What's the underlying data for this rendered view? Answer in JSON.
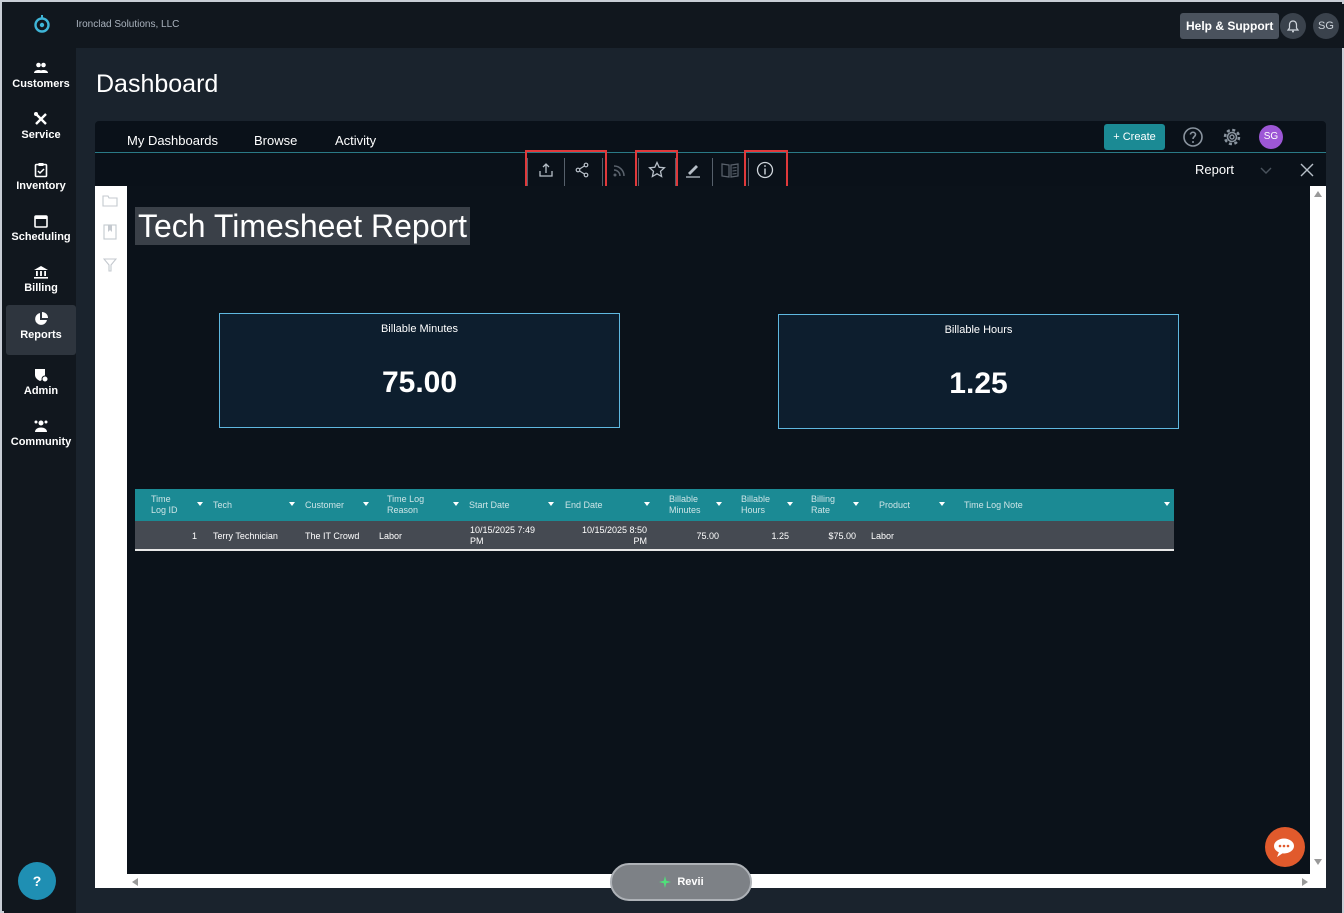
{
  "company_name": "Ironclad Solutions, LLC",
  "topbar": {
    "help_label": "Help & Support",
    "user_initials": "SG"
  },
  "sidebar": {
    "items": [
      {
        "label": "Customers",
        "icon": "users-icon"
      },
      {
        "label": "Service",
        "icon": "tools-icon"
      },
      {
        "label": "Inventory",
        "icon": "clipboard-icon"
      },
      {
        "label": "Scheduling",
        "icon": "calendar-icon"
      },
      {
        "label": "Billing",
        "icon": "bank-icon"
      },
      {
        "label": "Reports",
        "icon": "pie-chart-icon",
        "active": true
      },
      {
        "label": "Admin",
        "icon": "shield-gear-icon"
      },
      {
        "label": "Community",
        "icon": "community-icon"
      }
    ],
    "help_label": "?"
  },
  "page": {
    "title": "Dashboard"
  },
  "panel": {
    "tabs": [
      "My Dashboards",
      "Browse",
      "Activity"
    ],
    "create_label": "+  Create",
    "avatar": "SG",
    "view_label": "Report",
    "toolbar_icons": [
      "export-icon",
      "share-icon",
      "rss-icon",
      "star-icon",
      "edit-icon",
      "book-icon",
      "info-icon"
    ]
  },
  "report": {
    "title": "Tech Timesheet Report",
    "kpis": [
      {
        "label": "Billable Minutes",
        "value": "75.00"
      },
      {
        "label": "Billable Hours",
        "value": "1.25"
      }
    ],
    "table": {
      "columns": [
        "Time Log ID",
        "Tech",
        "Customer",
        "Time Log Reason",
        "Start Date",
        "End Date",
        "Billable Minutes",
        "Billable Hours",
        "Billing Rate",
        "Product",
        "Time Log Note"
      ],
      "rows": [
        [
          "1",
          "Terry Technician",
          "The IT Crowd",
          "Labor",
          "10/15/2025 7:49 PM",
          "10/15/2025 8:50 PM",
          "75.00",
          "1.25",
          "$75.00",
          "Labor",
          ""
        ]
      ]
    }
  },
  "assistant": {
    "label": "Revii"
  },
  "colors": {
    "accent": "#1b8a94",
    "highlight": "#e0393b",
    "avatar": "#9d57d6",
    "chat": "#e15a2c"
  }
}
